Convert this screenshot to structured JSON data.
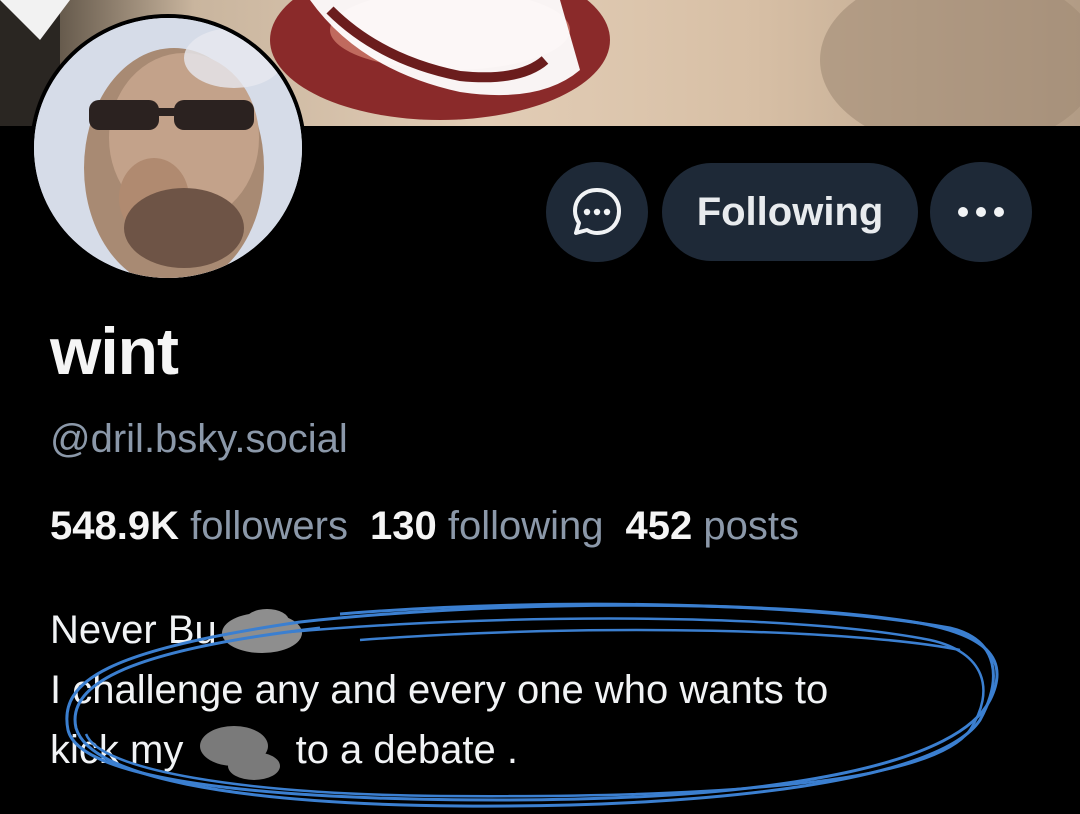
{
  "profile": {
    "display_name": "wint",
    "handle": "@dril.bsky.social",
    "stats": {
      "followers_count": "548.9K",
      "followers_label": "followers",
      "following_count": "130",
      "following_label": "following",
      "posts_count": "452",
      "posts_label": "posts"
    },
    "bio": {
      "line1": "Never Bu",
      "line2": "I challenge any and every one who wants to",
      "line3_start": "kick my",
      "line3_end": "to a debate ."
    }
  },
  "actions": {
    "message_icon": "chat-bubble-dots-icon",
    "follow_label": "Following",
    "more_icon": "ellipsis-icon"
  },
  "colors": {
    "background": "#000000",
    "button_bg": "#1e2937",
    "muted_text": "#8b98a9",
    "primary_text": "#f5f5f5",
    "scribble": "#3b82d4"
  }
}
